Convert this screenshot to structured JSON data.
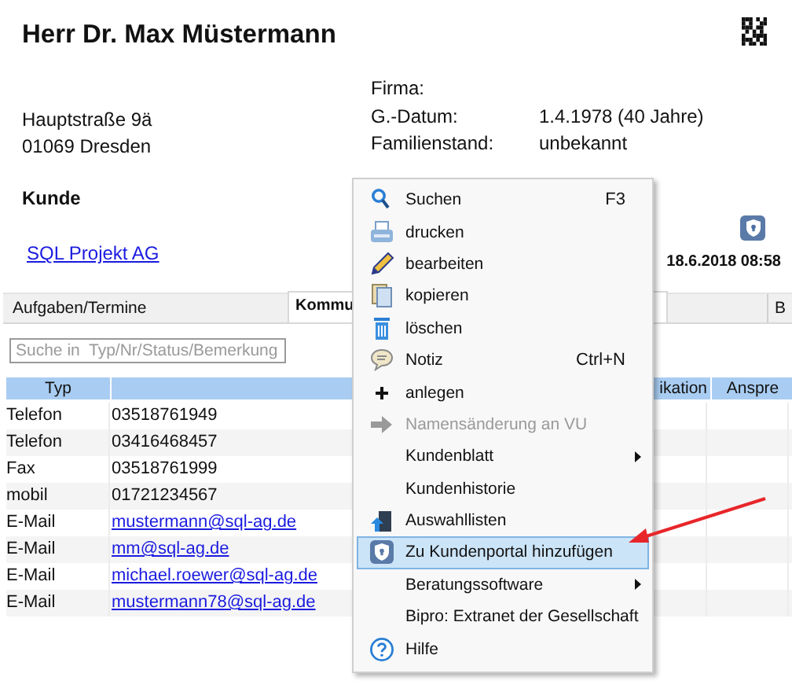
{
  "customer": {
    "name": "Herr Dr. Max Müstermann",
    "address": [
      "Hauptstraße 9ä",
      "01069 Dresden"
    ],
    "category": "Kunde",
    "company_link": "SQL Projekt AG"
  },
  "details": [
    {
      "label": "Firma:"
    },
    {
      "label": "G.-Datum:",
      "value": "1.4.1978 (40 Jahre)"
    },
    {
      "label": "Familienstand:",
      "value": "unbekannt"
    }
  ],
  "timestamp": "18.6.2018 08:58",
  "tabs": [
    {
      "label": "Aufgaben/Termine",
      "selected": false
    },
    {
      "label": "Kommu",
      "selected": true
    },
    {
      "label": "B",
      "selected": false
    }
  ],
  "search": {
    "placeholder": "Suche in  Typ/Nr/Status/Bemerkung"
  },
  "table": {
    "columns": [
      "Typ",
      "ikation",
      "Anspre"
    ],
    "rows": [
      {
        "type": "Telefon",
        "value": "03518761949",
        "kind": "text"
      },
      {
        "type": "Telefon",
        "value": "03416468457",
        "kind": "text"
      },
      {
        "type": "Fax",
        "value": "03518761999",
        "kind": "text"
      },
      {
        "type": "mobil",
        "value": "01721234567",
        "kind": "text"
      },
      {
        "type": "E-Mail",
        "value": "mustermann@sql-ag.de",
        "kind": "link"
      },
      {
        "type": "E-Mail",
        "value": "mm@sql-ag.de",
        "kind": "link"
      },
      {
        "type": "E-Mail",
        "value": "michael.roewer@sql-ag.de",
        "kind": "link"
      },
      {
        "type": "E-Mail",
        "value": "mustermann78@sql-ag.de",
        "kind": "link"
      }
    ]
  },
  "context_menu": {
    "items": [
      {
        "label": "Suchen",
        "shortcut": "F3",
        "selected": false,
        "disabled": false,
        "submenu": false
      },
      {
        "label": "drucken",
        "selected": false,
        "disabled": false,
        "submenu": false
      },
      {
        "label": "bearbeiten",
        "selected": false,
        "disabled": false,
        "submenu": false
      },
      {
        "label": "kopieren",
        "selected": false,
        "disabled": false,
        "submenu": false
      },
      {
        "label": "löschen",
        "selected": false,
        "disabled": false,
        "submenu": false
      },
      {
        "label": "Notiz",
        "shortcut": "Ctrl+N",
        "selected": false,
        "disabled": false,
        "submenu": false
      },
      {
        "label": "anlegen",
        "selected": false,
        "disabled": false,
        "submenu": false
      },
      {
        "label": "Namensänderung an VU",
        "selected": false,
        "disabled": true,
        "submenu": false
      },
      {
        "label": "Kundenblatt",
        "selected": false,
        "disabled": false,
        "submenu": true
      },
      {
        "label": "Kundenhistorie",
        "selected": false,
        "disabled": false,
        "submenu": false
      },
      {
        "label": "Auswahllisten",
        "selected": false,
        "disabled": false,
        "submenu": false
      },
      {
        "label": "Zu Kundenportal hinzufügen",
        "selected": true,
        "disabled": false,
        "submenu": false
      },
      {
        "label": "Beratungssoftware",
        "selected": false,
        "disabled": false,
        "submenu": true
      },
      {
        "label": "Bipro: Extranet der Gesellschaft",
        "selected": false,
        "disabled": false,
        "submenu": false
      },
      {
        "label": "Hilfe",
        "selected": false,
        "disabled": false,
        "submenu": false
      }
    ]
  }
}
